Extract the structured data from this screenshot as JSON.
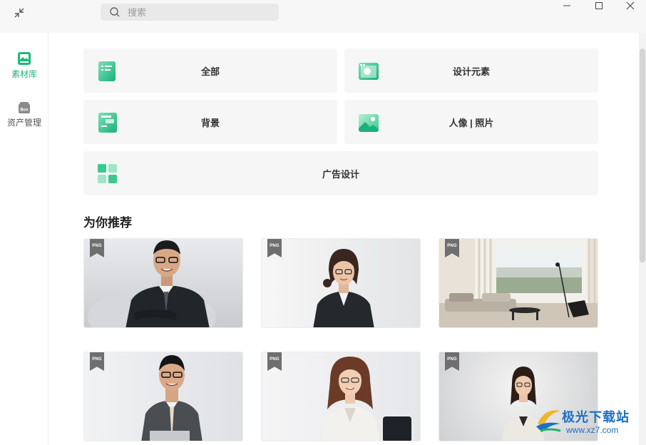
{
  "search": {
    "placeholder": "搜索"
  },
  "sidebar": {
    "items": [
      {
        "label": "素材库",
        "active": true
      },
      {
        "label": "资产管理",
        "active": false,
        "icon_text": "Box"
      }
    ]
  },
  "categories": [
    {
      "label": "全部"
    },
    {
      "label": "设计元素"
    },
    {
      "label": "背景"
    },
    {
      "label": "人像 | 照片"
    },
    {
      "label": "广告设计"
    }
  ],
  "section_title": "为你推荐",
  "thumbnails": [
    {
      "badge": "PNG"
    },
    {
      "badge": "PNG"
    },
    {
      "badge": "PNG"
    },
    {
      "badge": "PNG"
    },
    {
      "badge": "PNG"
    },
    {
      "badge": "PNG"
    }
  ],
  "watermark": {
    "title": "极光下载站",
    "url": "www.xz7.com"
  },
  "colors": {
    "accent": "#1db97a",
    "card_bg": "#f6f6f6",
    "titlebar_bg": "#f7f7f7"
  }
}
